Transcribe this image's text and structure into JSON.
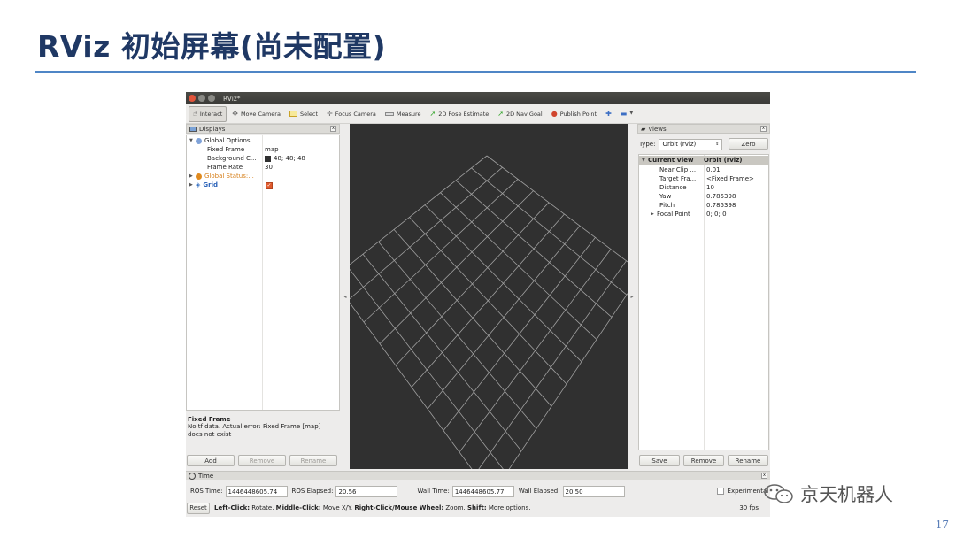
{
  "slide": {
    "title": "RViz 初始屏幕(尚未配置)",
    "page_number": "17",
    "watermark": "京天机器人"
  },
  "window": {
    "title": "RViz*"
  },
  "toolbar": {
    "tools": [
      {
        "label": "Interact",
        "icon": "hand-icon"
      },
      {
        "label": "Move Camera",
        "icon": "move-camera-icon"
      },
      {
        "label": "Select",
        "icon": "select-box-icon"
      },
      {
        "label": "Focus Camera",
        "icon": "focus-icon"
      },
      {
        "label": "Measure",
        "icon": "ruler-icon"
      },
      {
        "label": "2D Pose Estimate",
        "icon": "arrow-icon"
      },
      {
        "label": "2D Nav Goal",
        "icon": "arrow-icon"
      },
      {
        "label": "Publish Point",
        "icon": "pin-icon"
      }
    ]
  },
  "displays": {
    "header": "Displays",
    "global_options": "Global Options",
    "fixed_frame_label": "Fixed Frame",
    "fixed_frame_value": "map",
    "background_label": "Background C...",
    "background_value": "48; 48; 48",
    "frame_rate_label": "Frame Rate",
    "frame_rate_value": "30",
    "global_status": "Global Status:...",
    "grid": "Grid",
    "info_title": "Fixed Frame",
    "info_text": "No tf data. Actual error: Fixed Frame [map] does not exist",
    "add": "Add",
    "remove": "Remove",
    "rename": "Rename"
  },
  "views": {
    "header": "Views",
    "type_label": "Type:",
    "type_value": "Orbit (rviz)",
    "zero": "Zero",
    "current_view": "Current View",
    "current_view_value": "Orbit (rviz)",
    "props": [
      {
        "label": "Near Clip ...",
        "value": "0.01"
      },
      {
        "label": "Target Fra...",
        "value": "<Fixed Frame>"
      },
      {
        "label": "Distance",
        "value": "10"
      },
      {
        "label": "Yaw",
        "value": "0.785398"
      },
      {
        "label": "Pitch",
        "value": "0.785398"
      },
      {
        "label": "Focal Point",
        "value": "0; 0; 0"
      }
    ],
    "save": "Save",
    "remove": "Remove",
    "rename": "Rename"
  },
  "time": {
    "header": "Time",
    "ros_time_label": "ROS Time:",
    "ros_time": "1446448605.74",
    "ros_elapsed_label": "ROS Elapsed:",
    "ros_elapsed": "20.56",
    "wall_time_label": "Wall Time:",
    "wall_time": "1446448605.77",
    "wall_elapsed_label": "Wall Elapsed:",
    "wall_elapsed": "20.50",
    "experimental": "Experimental"
  },
  "status": {
    "reset": "Reset",
    "left_click": "Left-Click:",
    "left_click_action": " Rotate. ",
    "middle_click": "Middle-Click:",
    "middle_click_action": " Move X/Y. ",
    "right_click": "Right-Click/Mouse Wheel:",
    "right_click_action": " Zoom. ",
    "shift": "Shift:",
    "shift_action": " More options.",
    "fps": "30 fps"
  },
  "colors": {
    "title": "#1f3864",
    "viewport_bg": "#303030",
    "grid_line": "#a0a0a0",
    "background_swatch": "#303030"
  }
}
